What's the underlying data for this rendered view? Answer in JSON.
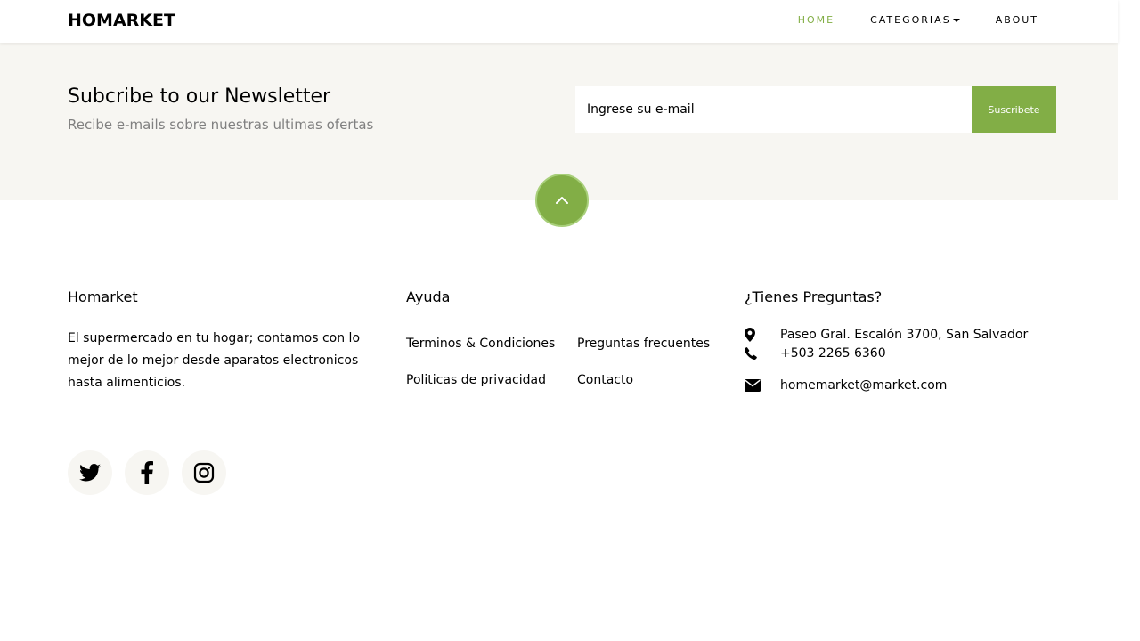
{
  "nav": {
    "brand": "HOMARKET",
    "links": [
      {
        "label": "HOME",
        "active": true
      },
      {
        "label": "CATEGORIAS",
        "dropdown": true
      },
      {
        "label": "ABOUT"
      }
    ]
  },
  "newsletter": {
    "title": "Subcribe to our Newsletter",
    "subtitle": "Recibe e-mails sobre nuestras ultimas ofertas",
    "input_placeholder": "Ingrese su e-mail",
    "button_label": "Suscribete"
  },
  "footer": {
    "about": {
      "title": "Homarket",
      "text": "El supermercado en tu hogar; contamos con lo mejor de lo mejor desde aparatos electronicos hasta alimenticios."
    },
    "help": {
      "title": "Ayuda",
      "links": [
        "Terminos & Condiciones",
        "Preguntas frecuentes",
        "Politicas de privacidad",
        "Contacto"
      ]
    },
    "contact": {
      "title": "¿Tienes Preguntas?",
      "address": "Paseo Gral. Escalón 3700, San Salvador",
      "phone": "+503 2265 6360",
      "email": "homemarket@market.com"
    },
    "social": [
      "twitter-icon",
      "facebook-icon",
      "instagram-icon"
    ]
  },
  "colors": {
    "accent": "#82ae46",
    "band": "#f7f6f2",
    "muted": "#808080"
  }
}
